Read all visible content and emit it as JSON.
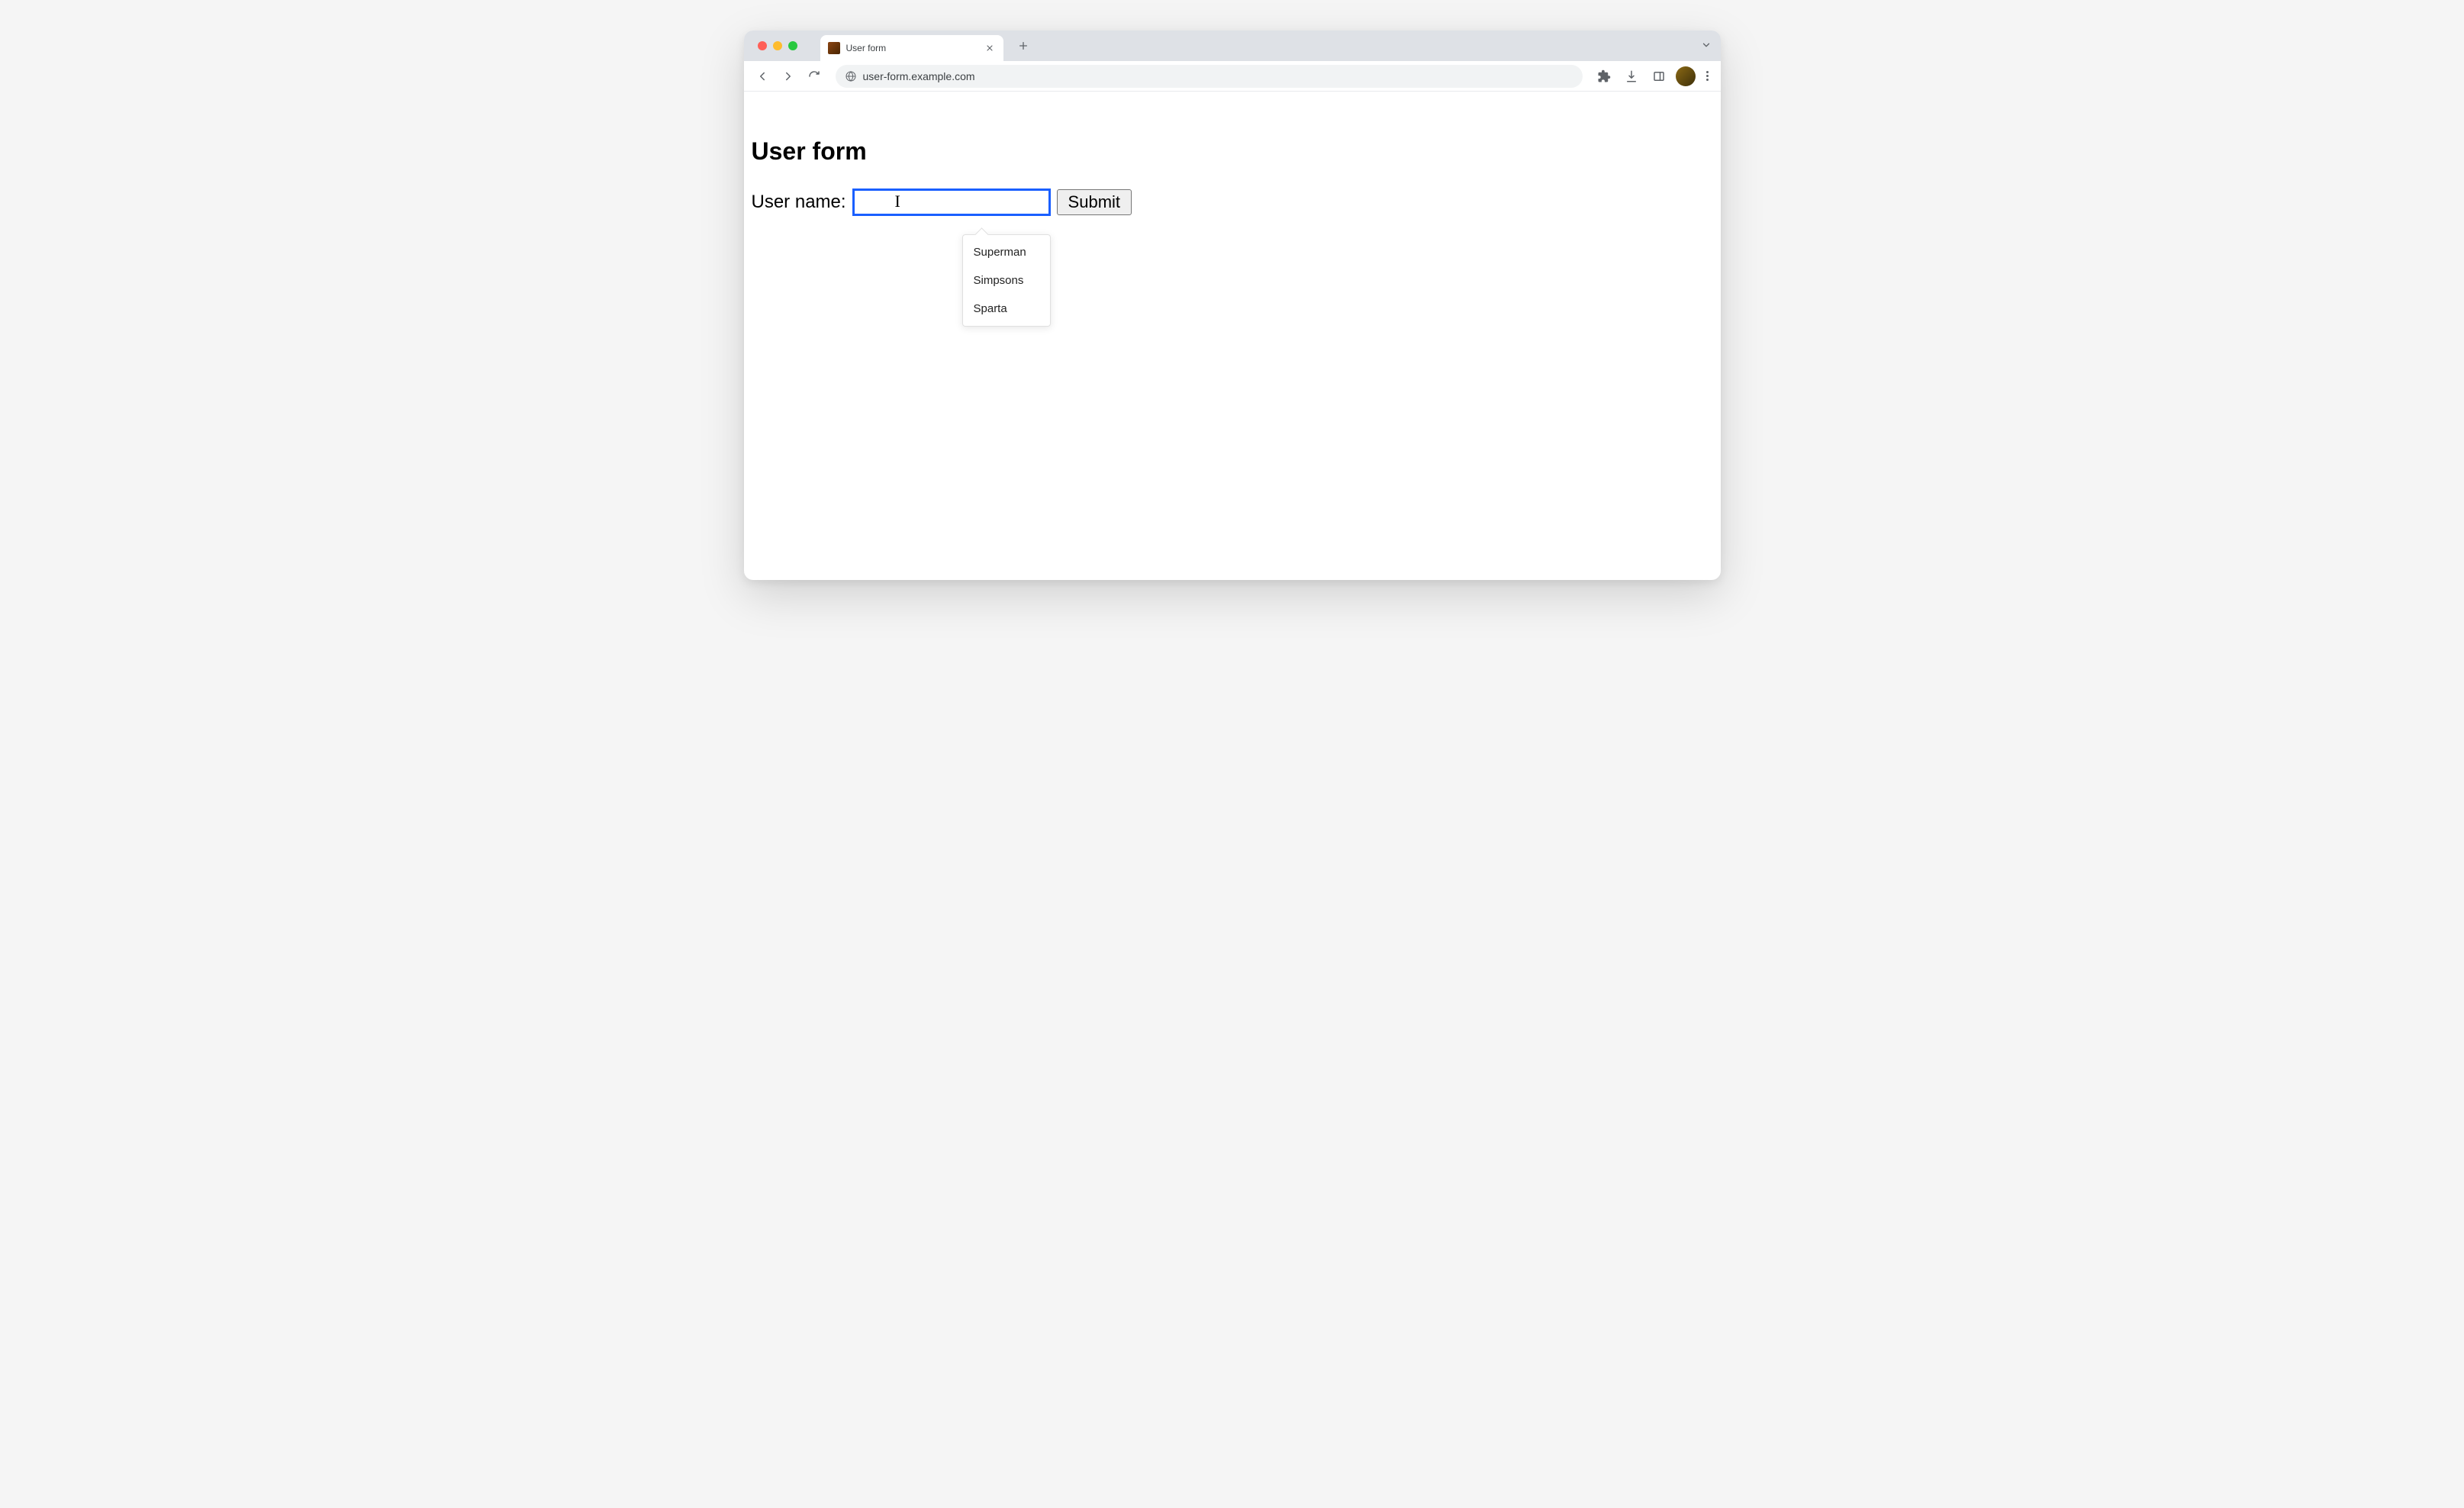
{
  "browser": {
    "tab_title": "User form",
    "url": "user-form.example.com"
  },
  "page": {
    "heading": "User form",
    "form": {
      "username_label": "User name:",
      "username_value": "",
      "submit_label": "Submit"
    },
    "autocomplete": {
      "items": [
        "Superman",
        "Simpsons",
        "Sparta"
      ]
    }
  }
}
